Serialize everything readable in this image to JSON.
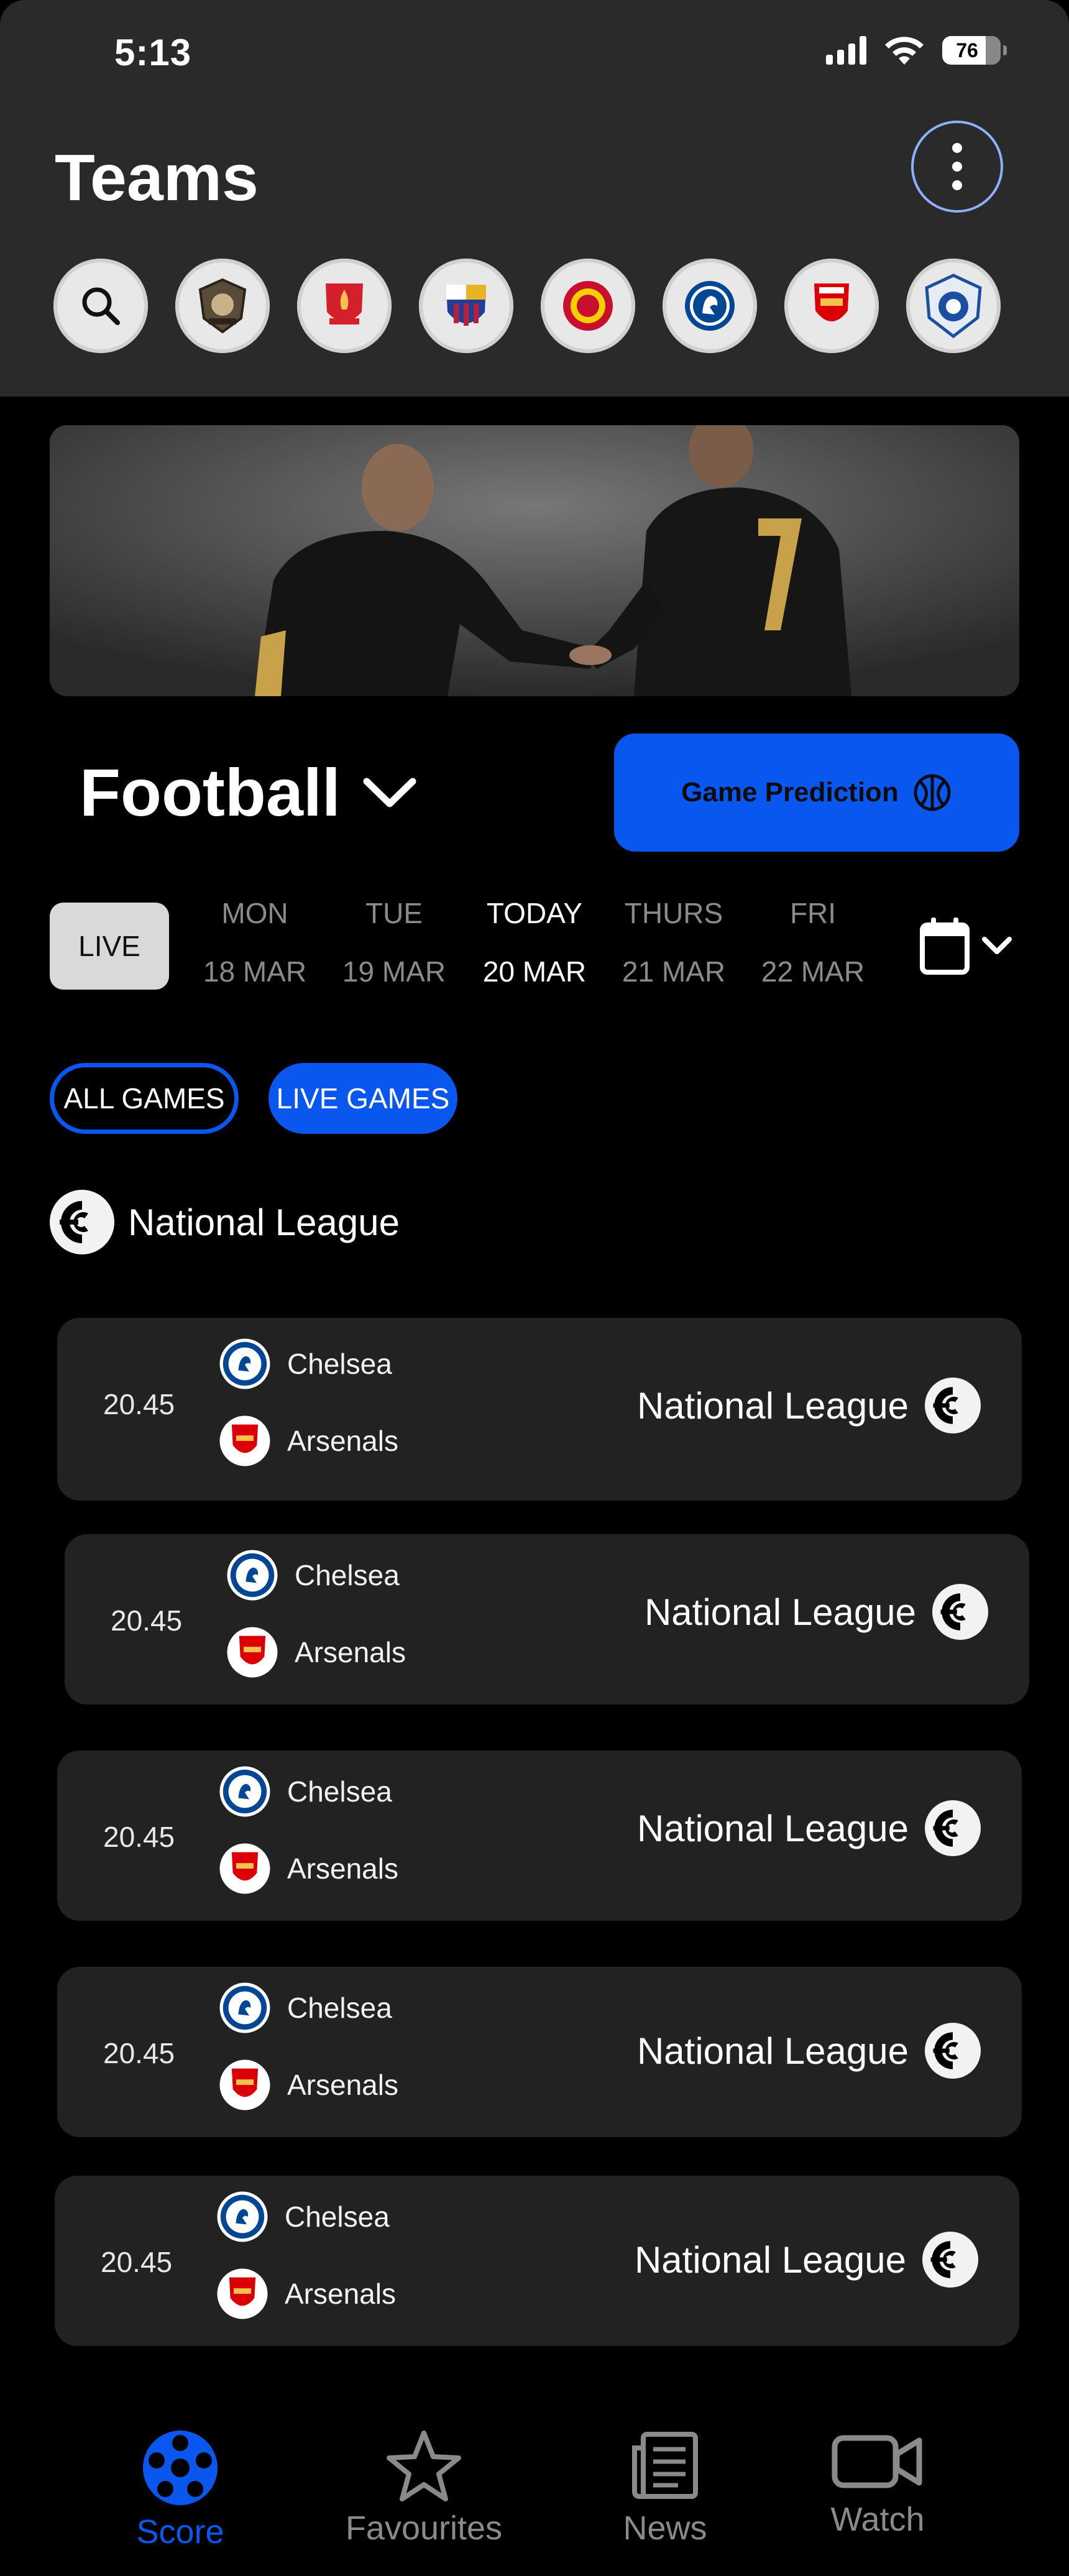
{
  "status_bar": {
    "time": "5:13",
    "battery": "76"
  },
  "header": {
    "title": "Teams",
    "more_icon": "more-vertical-icon",
    "teams": [
      {
        "icon": "search-icon"
      },
      {
        "icon": "team-crest-icon"
      },
      {
        "icon": "liverpool-crest-icon"
      },
      {
        "icon": "barcelona-crest-icon"
      },
      {
        "icon": "manchester-united-crest-icon"
      },
      {
        "icon": "chelsea-crest-icon"
      },
      {
        "icon": "arsenal-crest-icon"
      },
      {
        "icon": "team-crest-icon"
      }
    ]
  },
  "banner": {
    "image": "players-handshake-banner"
  },
  "sport": {
    "label": "Football",
    "icon": "chevron-down-icon"
  },
  "prediction_button": {
    "label": "Game Prediction",
    "icon": "basketball-icon"
  },
  "date_strip": {
    "live_label": "LIVE",
    "days": [
      {
        "name": "MON",
        "date": "18 MAR",
        "active": false
      },
      {
        "name": "TUE",
        "date": "19 MAR",
        "active": false
      },
      {
        "name": "TODAY",
        "date": "20 MAR",
        "active": true
      },
      {
        "name": "THURS",
        "date": "21 MAR",
        "active": false
      },
      {
        "name": "FRI",
        "date": "22 MAR",
        "active": false
      }
    ],
    "calendar_icon": "calendar-icon"
  },
  "filters": {
    "all": "ALL GAMES",
    "live": "LIVE GAMES"
  },
  "league_heading": "National League",
  "matches": [
    {
      "time": "20.45",
      "home": "Chelsea",
      "away": "Arsenals",
      "league": "National League"
    },
    {
      "time": "20.45",
      "home": "Chelsea",
      "away": "Arsenals",
      "league": "National League"
    },
    {
      "time": "20.45",
      "home": "Chelsea",
      "away": "Arsenals",
      "league": "National League"
    },
    {
      "time": "20.45",
      "home": "Chelsea",
      "away": "Arsenals",
      "league": "National League"
    },
    {
      "time": "20.45",
      "home": "Chelsea",
      "away": "Arsenals",
      "league": "National League"
    }
  ],
  "nav": {
    "items": [
      {
        "label": "Score",
        "icon": "football-icon",
        "active": true
      },
      {
        "label": "Favourites",
        "icon": "star-icon",
        "active": false
      },
      {
        "label": "News",
        "icon": "newspaper-icon",
        "active": false
      },
      {
        "label": "Watch",
        "icon": "video-camera-icon",
        "active": false
      }
    ]
  },
  "colors": {
    "accent": "#0a57f0",
    "card": "#222222",
    "header": "#2a2a2a",
    "muted": "#8a8a8a"
  }
}
